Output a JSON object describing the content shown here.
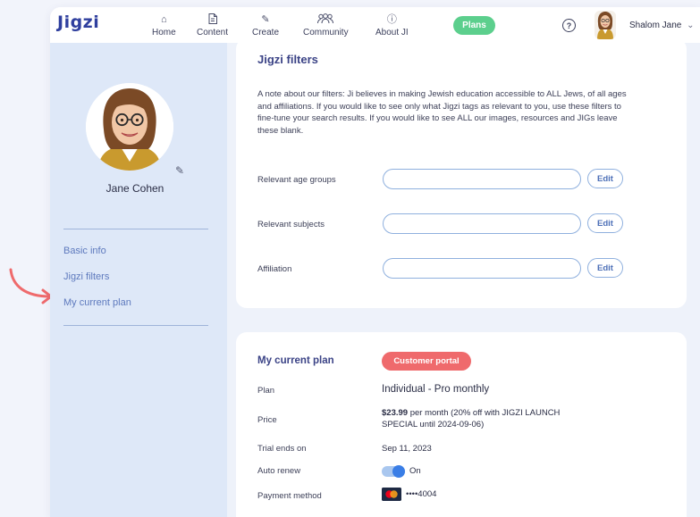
{
  "nav": {
    "logo": "Jigzi",
    "items": [
      {
        "label": "Home",
        "icon": "home-icon",
        "glyph": "⌂"
      },
      {
        "label": "Content",
        "icon": "document-icon",
        "glyph": "🗎"
      },
      {
        "label": "Create",
        "icon": "pencil-icon",
        "glyph": "✎"
      },
      {
        "label": "Community",
        "icon": "people-icon",
        "glyph": "ဇ"
      },
      {
        "label": "About JI",
        "icon": "info-icon",
        "glyph": "ⓘ"
      }
    ],
    "plans_label": "Plans",
    "help_glyph": "?",
    "user_name": "Shalom Jane",
    "user_chevron": "⌄"
  },
  "sidebar": {
    "profile_name": "Jane Cohen",
    "links": [
      {
        "label": "Basic info"
      },
      {
        "label": "Jigzi filters"
      },
      {
        "label": "My current plan"
      }
    ]
  },
  "filters": {
    "title": "Jigzi filters",
    "note": "A note about our filters: Ji believes in making Jewish education accessible to ALL Jews, of all ages and affiliations. If you would like to see only what Jigzi tags as relevant to you, use these filters to fine-tune your search results. If you would like to see ALL our images, resources and JIGs leave these blank.",
    "rows": [
      {
        "label": "Relevant age groups",
        "value": "",
        "button": "Edit"
      },
      {
        "label": "Relevant subjects",
        "value": "",
        "button": "Edit"
      },
      {
        "label": "Affiliation",
        "value": "",
        "button": "Edit"
      }
    ]
  },
  "plan": {
    "title": "My current plan",
    "portal_label": "Customer portal",
    "plan_label": "Plan",
    "plan_value": "Individual - Pro monthly",
    "price_label": "Price",
    "price_amount": "$23.99",
    "price_detail": "per month (20% off with JIGZI LAUNCH SPECIAL until 2024-09-06)",
    "trial_label": "Trial ends on",
    "trial_value": "Sep 11, 2023",
    "renew_label": "Auto renew",
    "renew_value": "On",
    "renew_on": true,
    "payment_label": "Payment method",
    "payment_value": "••••4004"
  },
  "colors": {
    "accent": "#3b4386",
    "plans_green": "#5ccf8d",
    "portal_red": "#ef6a6c",
    "sidebar_bg": "#dee8f8",
    "arrow": "#ef6a6c"
  }
}
